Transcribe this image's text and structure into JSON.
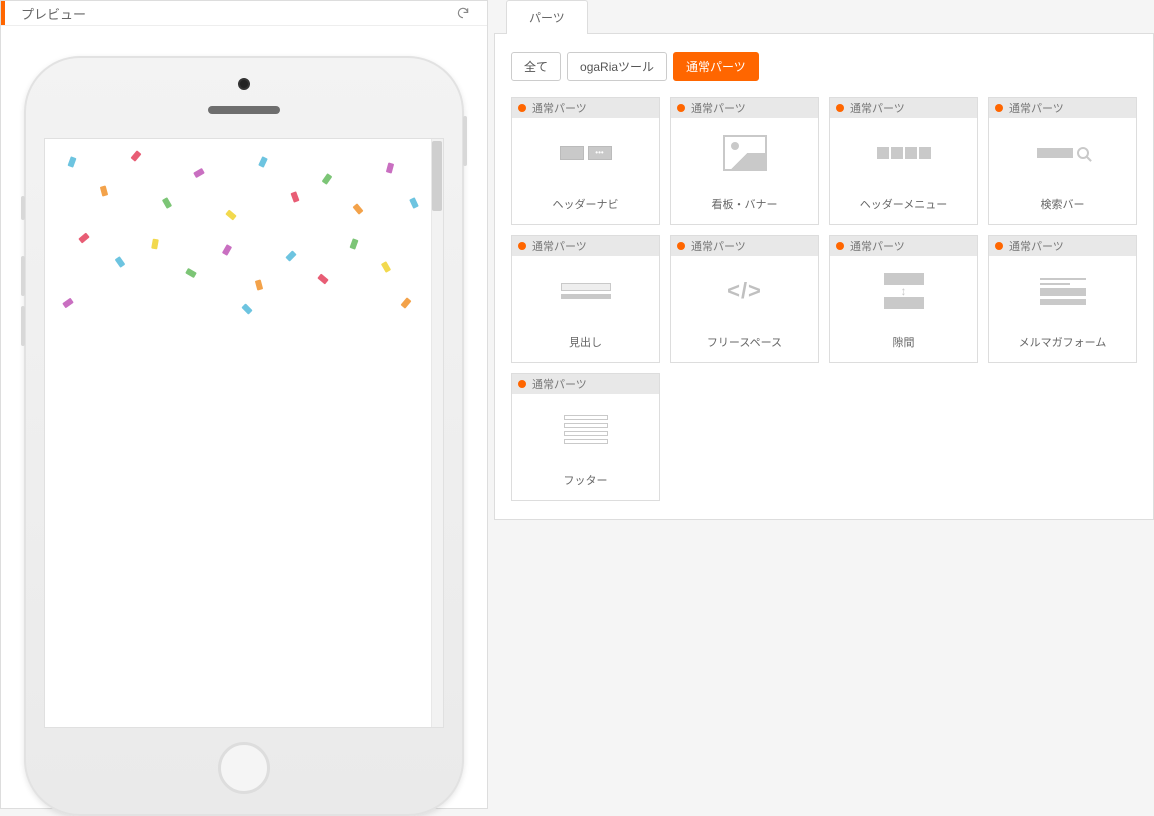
{
  "preview": {
    "title": "プレビュー"
  },
  "parts": {
    "tab_label": "パーツ",
    "filters": {
      "all": "全て",
      "ogaria": "ogaRiaツール",
      "normal": "通常パーツ"
    },
    "tag_label": "通常パーツ",
    "cards": [
      {
        "label": "ヘッダーナビ"
      },
      {
        "label": "看板・バナー"
      },
      {
        "label": "ヘッダーメニュー"
      },
      {
        "label": "検索バー"
      },
      {
        "label": "見出し"
      },
      {
        "label": "フリースペース"
      },
      {
        "label": "隙間"
      },
      {
        "label": "メルマガフォーム"
      },
      {
        "label": "フッター"
      }
    ]
  }
}
